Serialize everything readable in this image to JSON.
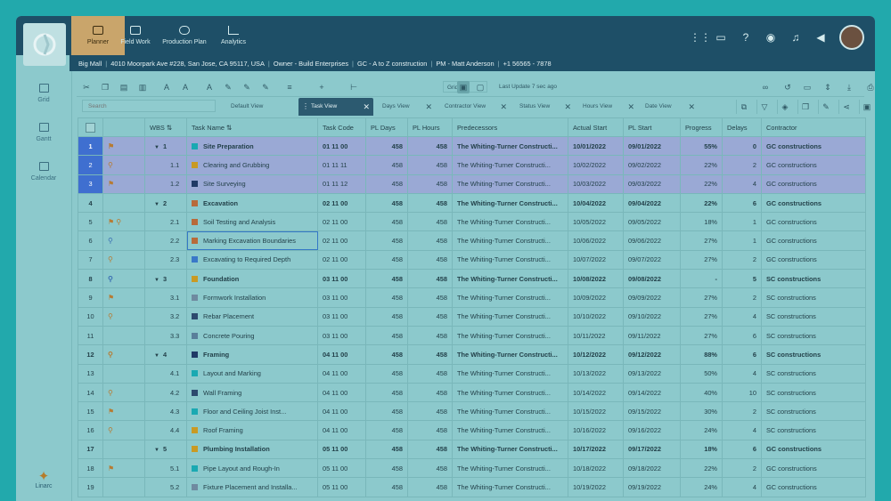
{
  "nav": [
    {
      "label": "Planner",
      "active": true
    },
    {
      "label": "Field Work",
      "active": false
    },
    {
      "label": "Production Plan",
      "active": false
    },
    {
      "label": "Analytics",
      "active": false
    }
  ],
  "info": [
    "Big Mall",
    "4010 Moorpark Ave #228, San Jose, CA 95117, USA",
    "Owner - Build Enterprises",
    "GC - A to Z construction",
    "PM - Matt Anderson",
    "+1 56565 - 7878"
  ],
  "sidebar": [
    {
      "label": "Grid"
    },
    {
      "label": "Gantt"
    },
    {
      "label": "Calendar"
    }
  ],
  "brand": "Linarc",
  "toolbar": {
    "grid_select": "Grid",
    "last_update": "Last Update 7 sec ago"
  },
  "search_placeholder": "Search",
  "views": [
    "Default View",
    "Task View",
    "Days View",
    "Contractor View",
    "Status View",
    "Hours View",
    "Date View"
  ],
  "columns": [
    "WBS",
    "Task Name",
    "Task Code",
    "PL Days",
    "PL Hours",
    "Predecessors",
    "Actual Start",
    "PL Start",
    "Progress",
    "Delays",
    "Contractor"
  ],
  "rows": [
    {
      "n": "1",
      "icons": "F",
      "wbs": "1",
      "name": "Site Preparation",
      "color": "#1aa9b2",
      "code": "01 11 00",
      "days": "458",
      "hours": "458",
      "pred": "The Whiting-Turner Constructi...",
      "actual": "10/01/2022",
      "pl": "09/01/2022",
      "prog": "55%",
      "delays": "0",
      "contractor": "GC constructions",
      "group": true,
      "sel": true
    },
    {
      "n": "2",
      "icons": "P",
      "wbs": "1.1",
      "name": "Clearing and Grubbing",
      "color": "#c99a24",
      "code": "01 11 11",
      "days": "458",
      "hours": "458",
      "pred": "The Whiting-Turner Constructi...",
      "actual": "10/02/2022",
      "pl": "09/02/2022",
      "prog": "22%",
      "delays": "2",
      "contractor": "GC constructions",
      "group": false,
      "sel": true
    },
    {
      "n": "3",
      "icons": "F",
      "wbs": "1.2",
      "name": "Site Surveying",
      "color": "#1f3a66",
      "code": "01 11 12",
      "days": "458",
      "hours": "458",
      "pred": "The Whiting-Turner Constructi...",
      "actual": "10/03/2022",
      "pl": "09/03/2022",
      "prog": "22%",
      "delays": "4",
      "contractor": "GC constructions",
      "group": false,
      "sel": true
    },
    {
      "n": "4",
      "icons": "",
      "wbs": "2",
      "name": "Excavation",
      "color": "#b86a3a",
      "code": "02 11 00",
      "days": "458",
      "hours": "458",
      "pred": "The Whiting-Turner Constructi...",
      "actual": "10/04/2022",
      "pl": "09/04/2022",
      "prog": "22%",
      "delays": "6",
      "contractor": "GC constructions",
      "group": true,
      "sel": false
    },
    {
      "n": "5",
      "icons": "FP",
      "wbs": "2.1",
      "name": "Soil Testing and Analysis",
      "color": "#b86a3a",
      "code": "02 11 00",
      "days": "458",
      "hours": "458",
      "pred": "The Whiting-Turner Constructi...",
      "actual": "10/05/2022",
      "pl": "09/05/2022",
      "prog": "18%",
      "delays": "1",
      "contractor": "GC constructions",
      "group": false,
      "sel": false
    },
    {
      "n": "6",
      "icons": "B",
      "wbs": "2.2",
      "name": "Marking Excavation Boundaries",
      "color": "#b86a3a",
      "code": "02 11 00",
      "days": "458",
      "hours": "458",
      "pred": "The Whiting-Turner Constructi...",
      "actual": "10/06/2022",
      "pl": "09/06/2022",
      "prog": "27%",
      "delays": "1",
      "contractor": "GC constructions",
      "group": false,
      "sel": false
    },
    {
      "n": "7",
      "icons": "P",
      "wbs": "2.3",
      "name": "Excavating to Required Depth",
      "color": "#3a78c8",
      "code": "02 11 00",
      "days": "458",
      "hours": "458",
      "pred": "The Whiting-Turner Constructi...",
      "actual": "10/07/2022",
      "pl": "09/07/2022",
      "prog": "27%",
      "delays": "2",
      "contractor": "GC constructions",
      "group": false,
      "sel": false
    },
    {
      "n": "8",
      "icons": "B",
      "wbs": "3",
      "name": "Foundation",
      "color": "#c99a24",
      "code": "03 11 00",
      "days": "458",
      "hours": "458",
      "pred": "The Whiting-Turner Constructi...",
      "actual": "10/08/2022",
      "pl": "09/08/2022",
      "prog": "-",
      "delays": "5",
      "contractor": "SC constructions",
      "group": true,
      "sel": false
    },
    {
      "n": "9",
      "icons": "F",
      "wbs": "3.1",
      "name": "Formwork Installation",
      "color": "#6f8aa0",
      "code": "03 11 00",
      "days": "458",
      "hours": "458",
      "pred": "The Whiting-Turner Constructi...",
      "actual": "10/09/2022",
      "pl": "09/09/2022",
      "prog": "27%",
      "delays": "2",
      "contractor": "SC constructions",
      "group": false,
      "sel": false
    },
    {
      "n": "10",
      "icons": "P",
      "wbs": "3.2",
      "name": "Rebar Placement",
      "color": "#2d4a6e",
      "code": "03 11 00",
      "days": "458",
      "hours": "458",
      "pred": "The Whiting-Turner Constructi...",
      "actual": "10/10/2022",
      "pl": "09/10/2022",
      "prog": "27%",
      "delays": "4",
      "contractor": "SC constructions",
      "group": false,
      "sel": false
    },
    {
      "n": "11",
      "icons": "",
      "wbs": "3.3",
      "name": "Concrete Pouring",
      "color": "#5a7f9a",
      "code": "03 11 00",
      "days": "458",
      "hours": "458",
      "pred": "The Whiting-Turner Constructi...",
      "actual": "10/11/2022",
      "pl": "09/11/2022",
      "prog": "27%",
      "delays": "6",
      "contractor": "SC constructions",
      "group": false,
      "sel": false
    },
    {
      "n": "12",
      "icons": "P",
      "wbs": "4",
      "name": "Framing",
      "color": "#1f3a66",
      "code": "04 11 00",
      "days": "458",
      "hours": "458",
      "pred": "The Whiting-Turner Constructi...",
      "actual": "10/12/2022",
      "pl": "09/12/2022",
      "prog": "88%",
      "delays": "6",
      "contractor": "SC constructions",
      "group": true,
      "sel": false
    },
    {
      "n": "13",
      "icons": "",
      "wbs": "4.1",
      "name": "Layout and Marking",
      "color": "#1aa9b2",
      "code": "04 11 00",
      "days": "458",
      "hours": "458",
      "pred": "The Whiting-Turner Constructi...",
      "actual": "10/13/2022",
      "pl": "09/13/2022",
      "prog": "50%",
      "delays": "4",
      "contractor": "SC constructions",
      "group": false,
      "sel": false
    },
    {
      "n": "14",
      "icons": "P",
      "wbs": "4.2",
      "name": "Wall Framing",
      "color": "#2d4a6e",
      "code": "04 11 00",
      "days": "458",
      "hours": "458",
      "pred": "The Whiting-Turner Constructi...",
      "actual": "10/14/2022",
      "pl": "09/14/2022",
      "prog": "40%",
      "delays": "10",
      "contractor": "SC constructions",
      "group": false,
      "sel": false
    },
    {
      "n": "15",
      "icons": "F",
      "wbs": "4.3",
      "name": "Floor and Ceiling Joist Inst...",
      "color": "#1aa9b2",
      "code": "04 11 00",
      "days": "458",
      "hours": "458",
      "pred": "The Whiting-Turner Constructi...",
      "actual": "10/15/2022",
      "pl": "09/15/2022",
      "prog": "30%",
      "delays": "2",
      "contractor": "SC constructions",
      "group": false,
      "sel": false
    },
    {
      "n": "16",
      "icons": "P",
      "wbs": "4.4",
      "name": "Roof Framing",
      "color": "#c99a24",
      "code": "04 11 00",
      "days": "458",
      "hours": "458",
      "pred": "The Whiting-Turner Constructi...",
      "actual": "10/16/2022",
      "pl": "09/16/2022",
      "prog": "24%",
      "delays": "4",
      "contractor": "SC constructions",
      "group": false,
      "sel": false
    },
    {
      "n": "17",
      "icons": "",
      "wbs": "5",
      "name": "Plumbing Installation",
      "color": "#c99a24",
      "code": "05 11 00",
      "days": "458",
      "hours": "458",
      "pred": "The Whiting-Turner Constructi...",
      "actual": "10/17/2022",
      "pl": "09/17/2022",
      "prog": "18%",
      "delays": "6",
      "contractor": "GC constructions",
      "group": true,
      "sel": false
    },
    {
      "n": "18",
      "icons": "F",
      "wbs": "5.1",
      "name": "Pipe Layout and Rough-In",
      "color": "#1aa9b2",
      "code": "05 11 00",
      "days": "458",
      "hours": "458",
      "pred": "The Whiting-Turner Constructi...",
      "actual": "10/18/2022",
      "pl": "09/18/2022",
      "prog": "22%",
      "delays": "2",
      "contractor": "GC constructions",
      "group": false,
      "sel": false
    },
    {
      "n": "19",
      "icons": "",
      "wbs": "5.2",
      "name": "Fixture Placement and Installa...",
      "color": "#6f8aa0",
      "code": "05 11 00",
      "days": "458",
      "hours": "458",
      "pred": "The Whiting-Turner Constructi...",
      "actual": "10/19/2022",
      "pl": "09/19/2022",
      "prog": "24%",
      "delays": "4",
      "contractor": "GC constructions",
      "group": false,
      "sel": false
    }
  ]
}
